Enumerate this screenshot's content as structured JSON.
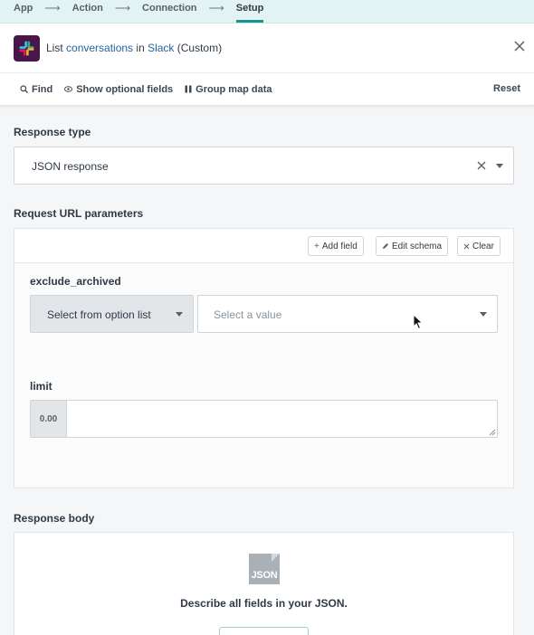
{
  "stepper": {
    "steps": [
      "App",
      "Action",
      "Connection",
      "Setup"
    ],
    "arrow": "⟶"
  },
  "header": {
    "prefix": "List ",
    "object": "conversations",
    "middle": " in ",
    "app": "Slack",
    "suffix": " (Custom)"
  },
  "toolbar": {
    "find": "Find",
    "optional": "Show optional fields",
    "group": "Group map data",
    "reset": "Reset"
  },
  "response_type": {
    "label": "Response type",
    "value": "JSON response"
  },
  "url_params": {
    "label": "Request URL parameters",
    "add_field": "Add field",
    "edit_schema": "Edit schema",
    "clear": "Clear",
    "fields": {
      "exclude_archived": {
        "label": "exclude_archived",
        "mode": "Select from option list",
        "placeholder": "Select a value"
      },
      "limit": {
        "label": "limit",
        "prefix": "0.00"
      }
    }
  },
  "response_body": {
    "label": "Response body",
    "icon_text": "JSON",
    "describe": "Describe all fields in your JSON."
  },
  "colors": {
    "accent": "#17968f",
    "link": "#24639f",
    "slack_bg": "#4a154b"
  }
}
